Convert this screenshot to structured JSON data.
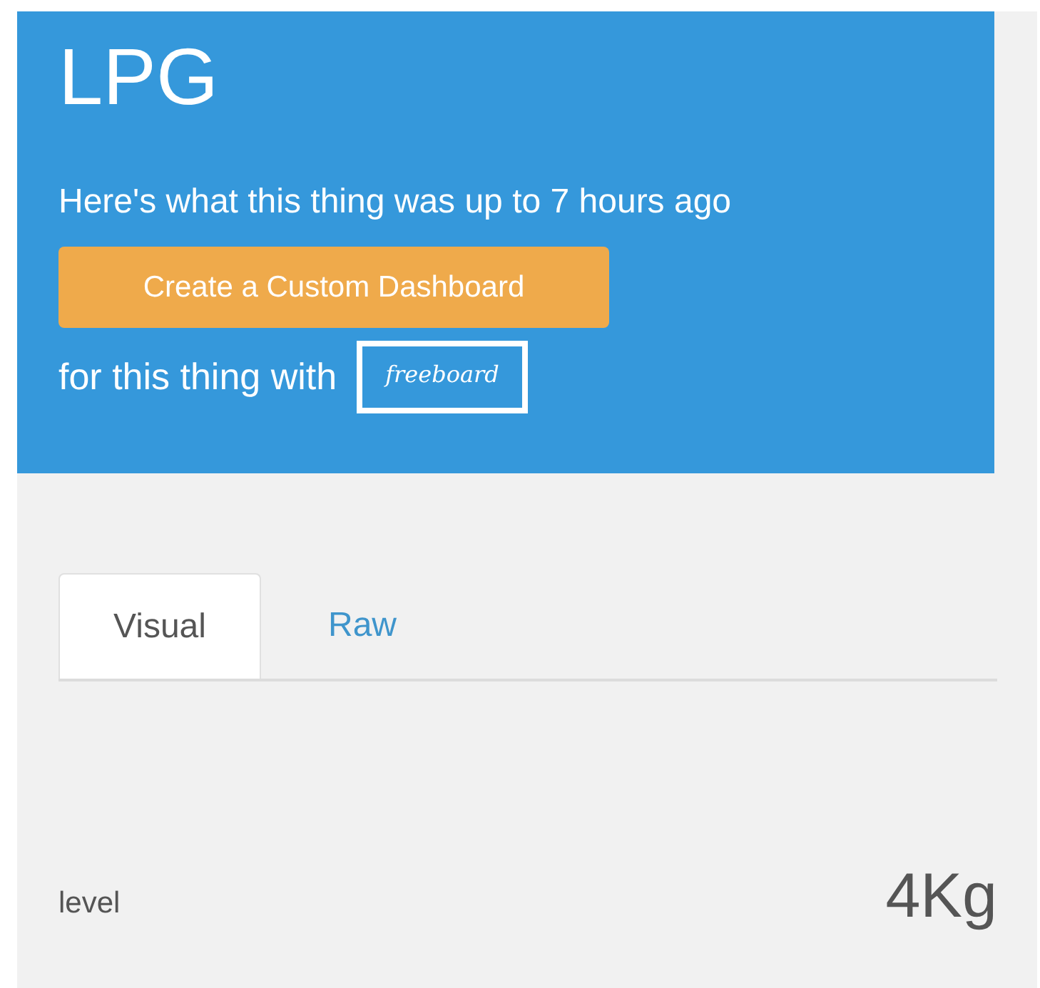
{
  "header": {
    "title": "LPG",
    "subtitle": "Here's what this thing was up to 7 hours ago",
    "button": "Create a Custom Dashboard",
    "with_text": "for this thing with",
    "link": "freeboard"
  },
  "tabs": [
    {
      "label": "Visual",
      "selected": true
    },
    {
      "label": "Raw",
      "selected": false
    }
  ],
  "readings": [
    {
      "name": "level",
      "value": "4Kg"
    }
  ]
}
